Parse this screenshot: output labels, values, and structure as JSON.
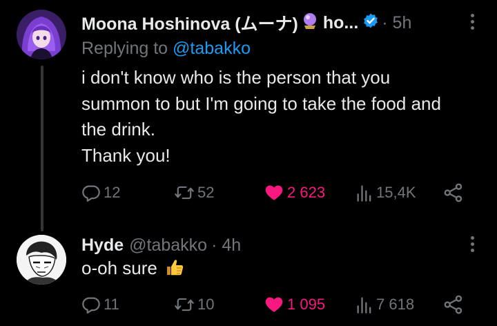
{
  "tweets": [
    {
      "name": "Moona Hoshinova (ムーナ)",
      "name_suffix": "ho...",
      "time": "· 5h",
      "reply_prefix": "Replying to",
      "reply_handle": "@tabakko",
      "lines": [
        "i don't know who is the person that you",
        "summon to but I'm going to take the food and",
        "the drink.",
        "Thank you!"
      ],
      "stats": {
        "replies": "12",
        "retweets": "52",
        "likes": "2 623",
        "views": "15,4K"
      }
    },
    {
      "name": "Hyde",
      "handle": "@tabakko",
      "time": "· 4h",
      "text": "o-oh sure",
      "stats": {
        "replies": "11",
        "retweets": "10",
        "likes": "1 095",
        "views": "7 618"
      }
    }
  ],
  "icons": {
    "avatar_1": "anime-girl-avatar",
    "orb": "crystal-ball-icon",
    "verified": "verified-badge-icon",
    "avatar_2": "manga-character-avatar",
    "emoji": "thumbs-up-emoji",
    "reply": "reply-icon",
    "retweet": "retweet-icon",
    "like": "heart-icon",
    "views": "views-icon",
    "share": "share-icon",
    "more": "more-icon"
  },
  "colors": {
    "background": "#000000",
    "text": "#e7e9ea",
    "muted": "#71767b",
    "link": "#1d9bf0",
    "like": "#f91880",
    "thread_line": "#333639"
  }
}
